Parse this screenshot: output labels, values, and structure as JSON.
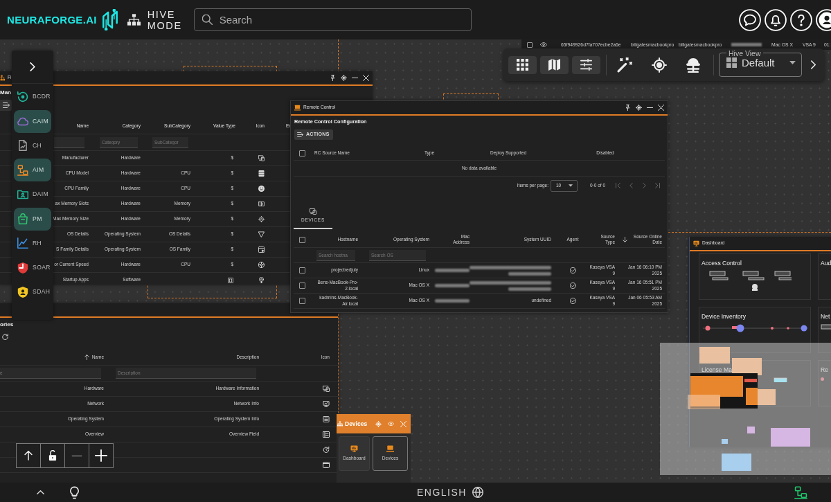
{
  "header": {
    "brand": "NEURAFORGE.AI",
    "mode_lines": [
      "HIVE",
      "MODE"
    ],
    "search": {
      "placeholder": "Search"
    }
  },
  "device_strip": {
    "checked": false,
    "cells": [
      {
        "kind": "text",
        "text": "65f949926d7fa707ecbe2a6e"
      },
      {
        "kind": "text",
        "text": "billgatesmacbookpro"
      },
      {
        "kind": "text",
        "text": "billgatesmacbookpro"
      },
      {
        "kind": "redacted"
      },
      {
        "kind": "text",
        "text": "Mac OS X"
      },
      {
        "kind": "text",
        "text": "VSA 9"
      },
      {
        "kind": "text",
        "text": "01:"
      }
    ]
  },
  "toolbar": {
    "hive_view": {
      "label": "Hive View",
      "value": "Default"
    }
  },
  "sidebar": {
    "items": [
      {
        "label": "BCDR",
        "selected": false,
        "color": "#1fb89c"
      },
      {
        "label": "CAIM",
        "selected": true,
        "color": "#9b6bd6"
      },
      {
        "label": "CH",
        "selected": false,
        "color": "#a0a0a0"
      },
      {
        "label": "AIM",
        "selected": true,
        "color": "#f08a24"
      },
      {
        "label": "DAIM",
        "selected": false,
        "color": "#1fb89c"
      },
      {
        "label": "PM",
        "selected": true,
        "color": "#2ec46e"
      },
      {
        "label": "RH",
        "selected": false,
        "color": "#3b8fe0"
      },
      {
        "label": "SOAR",
        "selected": false,
        "color": "#e03a3a"
      },
      {
        "label": "SDAH",
        "selected": false,
        "color": "#f2c521"
      }
    ]
  },
  "field_window": {
    "title": "Fi",
    "heading": "Man",
    "columns": [
      "Name",
      "Category",
      "SubCategory",
      "Value Type",
      "Icon",
      "Er"
    ],
    "filters": [
      {
        "kind": "input"
      },
      {
        "kind": "input",
        "placeholder": "Category"
      },
      {
        "kind": "input",
        "placeholder": "SubCategor"
      }
    ],
    "rows": [
      {
        "name": "Manufacturer",
        "category": "Hardware",
        "value_type": {
          "kind": "text",
          "text": "$"
        }
      },
      {
        "name": "CPU Model",
        "category": "Hardware",
        "subcategory": "CPU",
        "value_type": {
          "kind": "text",
          "text": "$"
        }
      },
      {
        "name": "CPU Family",
        "category": "Hardware",
        "subcategory": "CPU",
        "value_type": {
          "kind": "text",
          "text": "$"
        }
      },
      {
        "name": "ax Memory Slots",
        "category": "Hardware",
        "subcategory": "Memory",
        "value_type": {
          "kind": "text",
          "text": "$"
        }
      },
      {
        "name": "Max Memory Size",
        "category": "Hardware",
        "subcategory": "Memory",
        "value_type": {
          "kind": "text",
          "text": "$"
        }
      },
      {
        "name": "OS Details",
        "category": "Operating System",
        "subcategory": "OS Details",
        "value_type": {
          "kind": "text",
          "text": "$"
        }
      },
      {
        "name": "S Family Details",
        "category": "Operating System",
        "subcategory": "OS Family",
        "value_type": {
          "kind": "text",
          "text": "$"
        }
      },
      {
        "name": "or Current Speed",
        "category": "Hardware",
        "subcategory": "CPU",
        "value_type": {
          "kind": "text",
          "text": "$"
        }
      },
      {
        "name": "Startup Apps",
        "category": "Software",
        "value_type": {
          "kind": "icon"
        }
      }
    ]
  },
  "remote_window": {
    "title": "Remote Control",
    "heading": "Remote Control Configuration",
    "actions_label": "ACTIONS",
    "select_all_checked": false,
    "columns": [
      "RC Source Name",
      "Type",
      "Deploy Supported",
      "Disabled"
    ],
    "empty_text": "No data available",
    "pagination": {
      "label": "Items per page:",
      "page_size": "10",
      "range": "0-0 of 0"
    },
    "tabs": [
      {
        "label": "DEVICES",
        "selected": true
      }
    ],
    "devices": {
      "select_all_checked": false,
      "columns": [
        {
          "label": "Hostname"
        },
        {
          "label": "Operating System"
        },
        {
          "label": "Mac Address"
        },
        {
          "label": "System UUID"
        },
        {
          "label": "Agent"
        },
        {
          "label": "Source Type"
        },
        {
          "label": "Source Online Date",
          "sort_descending": true
        }
      ],
      "filters": [
        {
          "placeholder": "Search hostna"
        },
        {
          "placeholder": "Search OS"
        }
      ],
      "rows": [
        {
          "checked": false,
          "hostname": "projectredjuly",
          "os": "Linux",
          "mac": {
            "kind": "redacted"
          },
          "uuid": {
            "kind": "redacted"
          },
          "agent": true,
          "source_type": "Kaseya VSA 9",
          "online_date": "Jan 16 06:10 PM 2025"
        },
        {
          "checked": false,
          "hostname": "Bens-MacBook-Pro-2.local",
          "os": "Mac OS X",
          "mac": {
            "kind": "redacted"
          },
          "uuid": {
            "kind": "redacted"
          },
          "agent": true,
          "source_type": "Kaseya VSA 9",
          "online_date": "Jan 16 05:51 PM 2025"
        },
        {
          "checked": false,
          "hostname": "kadmins-MacBook-Air.local",
          "os": "Mac OS X",
          "mac": {
            "kind": "redacted"
          },
          "uuid": {
            "kind": "text",
            "text": "undefined"
          },
          "agent": true,
          "source_type": "Kaseya VSA 9",
          "online_date": "Jan 06 05:53 AM 2025"
        }
      ]
    }
  },
  "categories_window": {
    "heading": "ories",
    "columns": [
      {
        "label": "Name",
        "sort_ascending": true
      },
      {
        "label": "Description"
      },
      {
        "label": "Icon"
      }
    ],
    "filters": [
      {
        "placeholder": "e"
      },
      {
        "placeholder": "Description"
      }
    ],
    "rows": [
      {
        "name": "Hardware",
        "description": "Hardware Information"
      },
      {
        "name": "Network",
        "description": "Network Info"
      },
      {
        "name": "Operating System",
        "description": "Operating System Info"
      },
      {
        "name": "Overview",
        "description": "Overview Field"
      },
      {},
      {}
    ]
  },
  "zoom_controls": {
    "locked": false
  },
  "devices_widget": {
    "title": "Devices",
    "tiles": [
      {
        "label": "Dashboard",
        "selected": false
      },
      {
        "label": "Devices",
        "selected": true
      }
    ]
  },
  "dashboard_window": {
    "title": "Dashboard",
    "cards": [
      {
        "title": "Access Control"
      },
      {
        "title": "Aud"
      },
      {
        "title": "Device Inventory"
      },
      {
        "title": "Net"
      },
      {
        "title": "License Ma"
      },
      {
        "title": "Re"
      }
    ]
  },
  "footer": {
    "language": "ENGLISH"
  }
}
